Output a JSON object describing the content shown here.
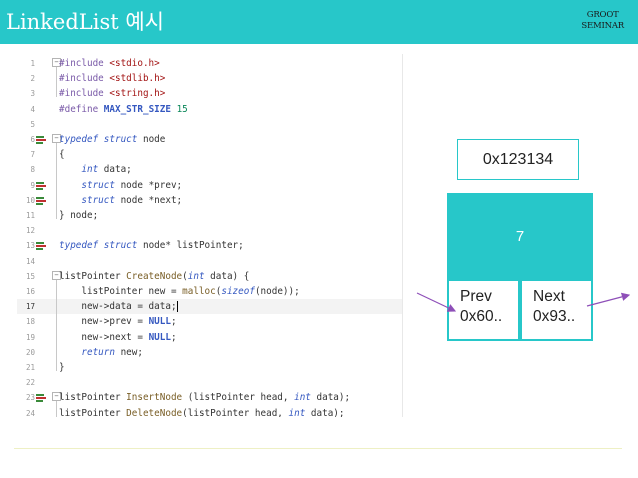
{
  "header": {
    "title": "LinkedList 예시",
    "logo_line1": "GROOT",
    "logo_line2": "SEMINAR"
  },
  "code": {
    "current_line": 17,
    "lines": [
      {
        "n": "1",
        "t": "#include <stdio.h>"
      },
      {
        "n": "2",
        "t": "#include <stdlib.h>"
      },
      {
        "n": "3",
        "t": "#include <string.h>"
      },
      {
        "n": "4",
        "t": "#define MAX_STR_SIZE 15"
      },
      {
        "n": "5",
        "t": ""
      },
      {
        "n": "6",
        "t": "typedef struct node"
      },
      {
        "n": "7",
        "t": "{"
      },
      {
        "n": "8",
        "t": "    int data;"
      },
      {
        "n": "9",
        "t": "    struct node *prev;"
      },
      {
        "n": "10",
        "t": "    struct node *next;"
      },
      {
        "n": "11",
        "t": "} node;"
      },
      {
        "n": "12",
        "t": ""
      },
      {
        "n": "13",
        "t": "typedef struct node* listPointer;"
      },
      {
        "n": "14",
        "t": ""
      },
      {
        "n": "15",
        "t": "listPointer CreateNode(int data) {"
      },
      {
        "n": "16",
        "t": "    listPointer new = malloc(sizeof(node));"
      },
      {
        "n": "17",
        "t": "    new->data = data;"
      },
      {
        "n": "18",
        "t": "    new->prev = NULL;"
      },
      {
        "n": "19",
        "t": "    new->next = NULL;"
      },
      {
        "n": "20",
        "t": "    return new;"
      },
      {
        "n": "21",
        "t": "}"
      },
      {
        "n": "22",
        "t": ""
      },
      {
        "n": "23",
        "t": "listPointer InsertNode (listPointer head, int data);"
      },
      {
        "n": "24",
        "t": "listPointer DeleteNode(listPointer head, int data);"
      }
    ]
  },
  "diagram": {
    "address": "0x123134",
    "value": "7",
    "prev_label": "Prev",
    "prev_value": "0x60..",
    "next_label": "Next",
    "next_value": "0x93.."
  },
  "colors": {
    "accent": "#27c7c9",
    "code_keyword": "#3558c0",
    "code_preprocessor": "#7a5aa8",
    "code_string": "#a31515",
    "code_number": "#098658",
    "arrow": "#8e4fb8"
  }
}
